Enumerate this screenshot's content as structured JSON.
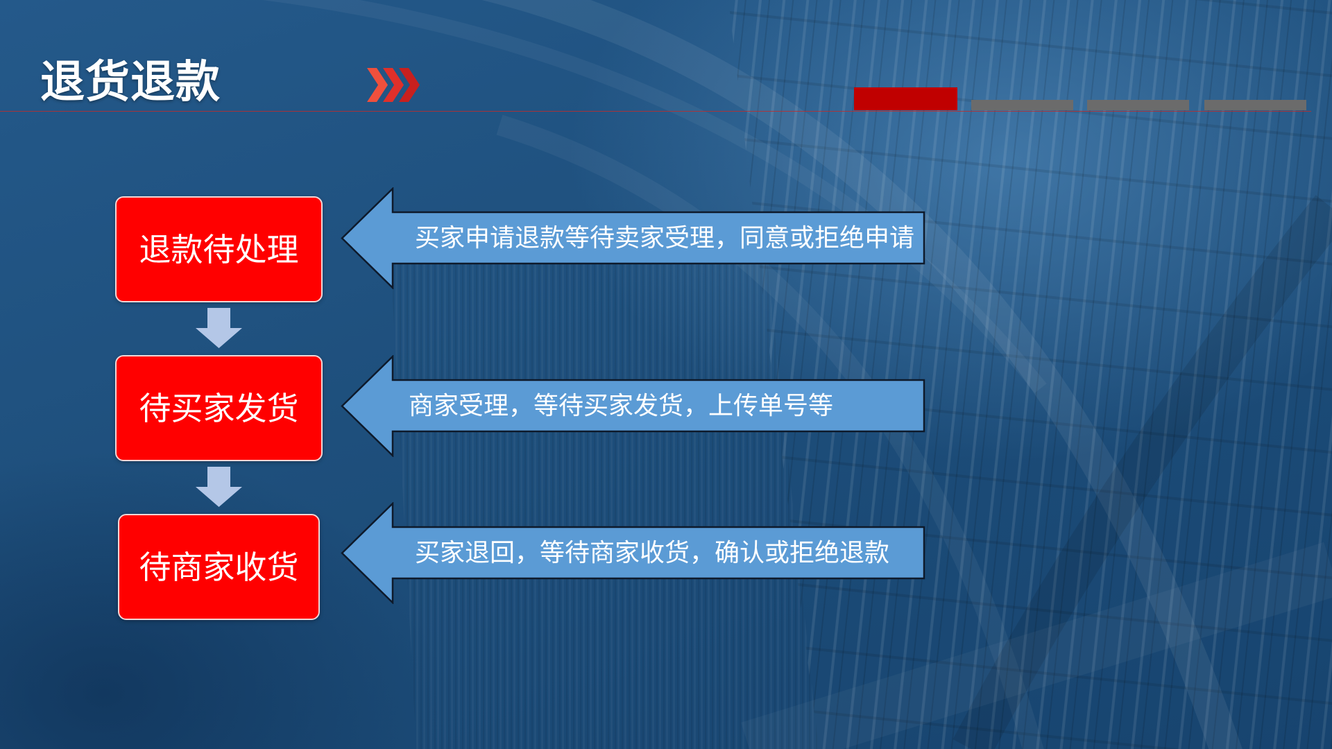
{
  "slide": {
    "title": "退货退款",
    "title_icon": "chevron-triple-right-icon",
    "background_icon": "library-bookshelf-image"
  },
  "flow": {
    "connector_icon": "arrow-down-icon",
    "callout_icon": "arrow-left-callout",
    "steps": [
      {
        "label": "退款待处理",
        "description": "买家申请退款等待卖家受理，同意或拒绝申请"
      },
      {
        "label": "待买家发货",
        "description": "商家受理，等待买家发货，上传单号等"
      },
      {
        "label": "待商家收货",
        "description": "买家退回，等待商家收货，确认或拒绝退款"
      }
    ]
  },
  "colors": {
    "background": "#1E4F7C",
    "title_text": "#FFFFFF",
    "step_box": "#FF0000",
    "step_box_border": "#F4D6D6",
    "callout_arrow": "#5B9BD5",
    "callout_outline": "#0E1A2B",
    "down_arrow": "#B4C7E7",
    "accent_red": "#C00000",
    "accent_gray": "#6B6B6B",
    "chevron_red": "#E03A2F"
  }
}
